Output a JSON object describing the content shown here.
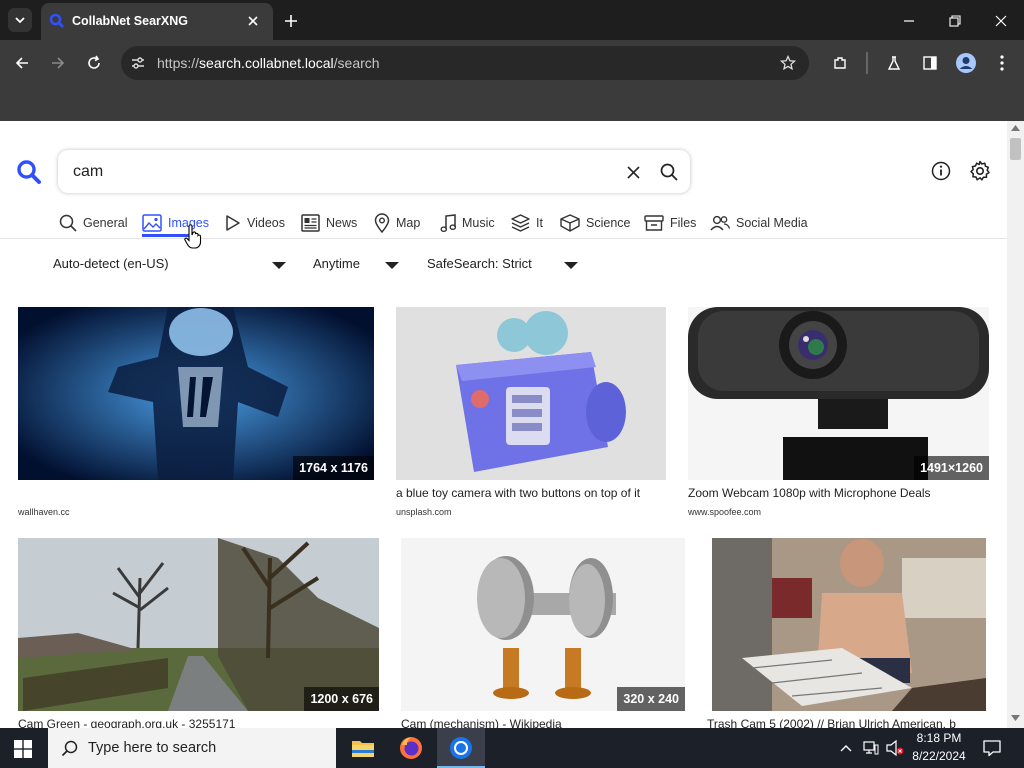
{
  "browser": {
    "tab_title": "CollabNet SearXNG",
    "url_scheme": "https://",
    "url_host": "search.collabnet.local",
    "url_path": "/search"
  },
  "search": {
    "query": "cam",
    "categories": [
      "General",
      "Images",
      "Videos",
      "News",
      "Map",
      "Music",
      "It",
      "Science",
      "Files",
      "Social Media"
    ],
    "active_category": "Images",
    "filters": {
      "language": "Auto-detect (en-US)",
      "time": "Anytime",
      "safesearch": "SafeSearch: Strict"
    }
  },
  "results": [
    {
      "resolution": "1764 x 1176",
      "title": "",
      "source": "wallhaven.cc"
    },
    {
      "resolution": "",
      "title": "a blue toy camera with two buttons on top of it",
      "source": "unsplash.com"
    },
    {
      "resolution": "1491×1260",
      "title": "Zoom Webcam 1080p with Microphone Deals",
      "source": "www.spoofee.com"
    },
    {
      "resolution": "1200 x 676",
      "title": "Cam Green - geograph.org.uk - 3255171",
      "source": ""
    },
    {
      "resolution": "320 x 240",
      "title": "Cam (mechanism) - Wikipedia",
      "source": ""
    },
    {
      "resolution": "",
      "title": "Trash Cam 5 (2002) // Brian Ulrich American, b",
      "source": ""
    }
  ],
  "taskbar": {
    "search_placeholder": "Type here to search",
    "time": "8:18 PM",
    "date": "8/22/2024"
  },
  "colors": {
    "accent": "#3050ff",
    "chrome_dark": "#1e1e1e",
    "chrome": "#3b3b3b"
  }
}
